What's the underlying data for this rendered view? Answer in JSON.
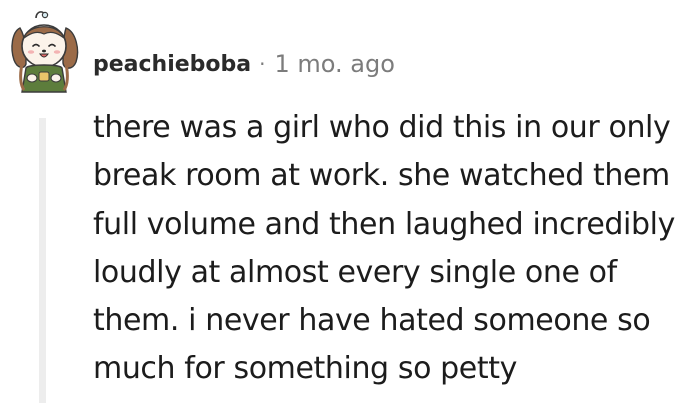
{
  "comment": {
    "username": "peachieboba",
    "separator": "·",
    "age": "1 mo. ago",
    "avatar_icon": "dog-avatar-icon",
    "body_lines": [
      "there was a girl who did this in our only",
      "break room at work. she watched them",
      "full volume and then laughed incredibly",
      "loudly at almost every single one of",
      "them. i never have hated someone so",
      "much for something so petty"
    ]
  },
  "colors": {
    "username": "#2b2b2b",
    "meta": "#7c7c7c",
    "thread_line": "#ededed",
    "text": "#1c1c1c"
  }
}
